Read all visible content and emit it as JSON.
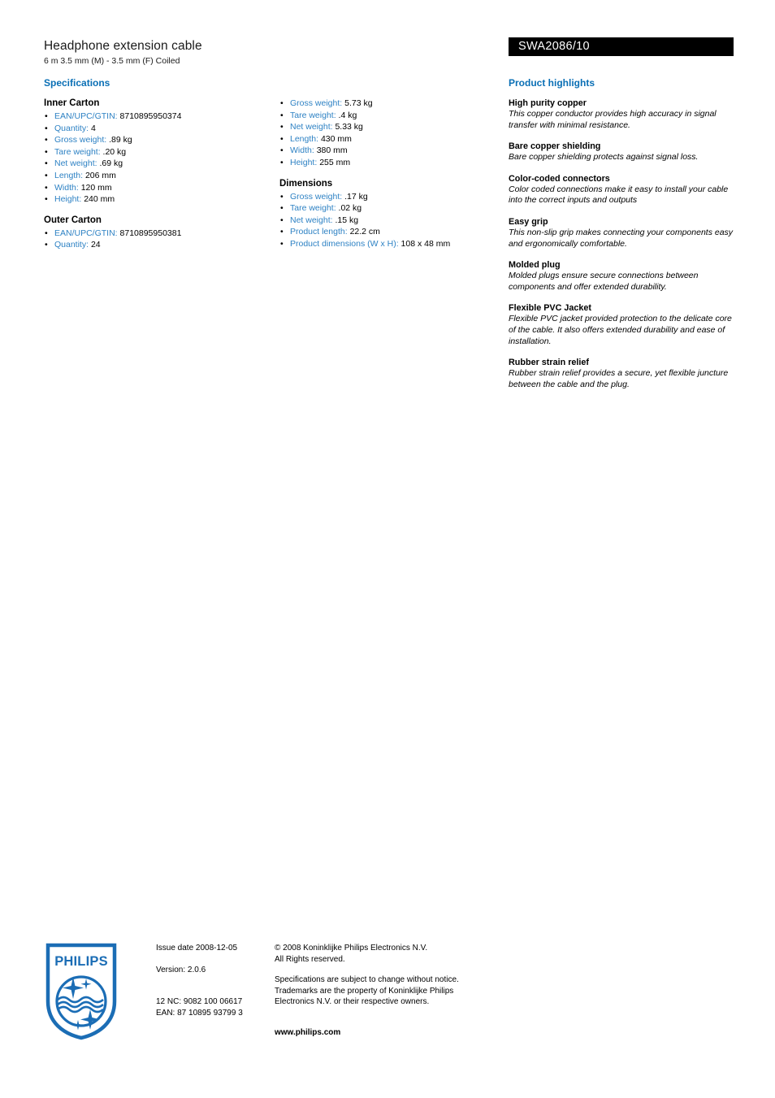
{
  "header": {
    "title": "Headphone extension cable",
    "subtitle": "6 m 3.5 mm (M) - 3.5 mm (F) Coiled",
    "model_code": "SWA2086/10"
  },
  "colors": {
    "heading_blue": "#0A6FB5",
    "label_blue": "#2E82C4",
    "banner_bg": "#000000",
    "logo_blue": "#1B6DB5"
  },
  "specifications": {
    "heading": "Specifications",
    "column1": [
      {
        "title": "Inner Carton",
        "items": [
          {
            "label": "EAN/UPC/GTIN:",
            "value": "8710895950374"
          },
          {
            "label": "Quantity:",
            "value": "4"
          },
          {
            "label": "Gross weight:",
            "value": ".89 kg"
          },
          {
            "label": "Tare weight:",
            "value": ".20 kg"
          },
          {
            "label": "Net weight:",
            "value": ".69 kg"
          },
          {
            "label": "Length:",
            "value": "206 mm"
          },
          {
            "label": "Width:",
            "value": "120 mm"
          },
          {
            "label": "Height:",
            "value": "240 mm"
          }
        ]
      },
      {
        "title": "Outer Carton",
        "items": [
          {
            "label": "EAN/UPC/GTIN:",
            "value": "8710895950381"
          },
          {
            "label": "Quantity:",
            "value": "24"
          }
        ]
      }
    ],
    "column2": [
      {
        "title": "",
        "headless": true,
        "items": [
          {
            "label": "Gross weight:",
            "value": "5.73 kg"
          },
          {
            "label": "Tare weight:",
            "value": ".4 kg"
          },
          {
            "label": "Net weight:",
            "value": "5.33 kg"
          },
          {
            "label": "Length:",
            "value": "430 mm"
          },
          {
            "label": "Width:",
            "value": "380 mm"
          },
          {
            "label": "Height:",
            "value": "255 mm"
          }
        ]
      },
      {
        "title": "Dimensions",
        "items": [
          {
            "label": "Gross weight:",
            "value": ".17 kg"
          },
          {
            "label": "Tare weight:",
            "value": ".02 kg"
          },
          {
            "label": "Net weight:",
            "value": ".15 kg"
          },
          {
            "label": "Product length:",
            "value": "22.2 cm"
          },
          {
            "label": "Product dimensions (W x H):",
            "value": "108 x 48 mm"
          }
        ]
      }
    ],
    "bullet_glyph": "•"
  },
  "highlights": {
    "heading": "Product highlights",
    "items": [
      {
        "title": "High purity copper",
        "desc": "This copper conductor provides high accuracy in signal transfer with minimal resistance."
      },
      {
        "title": "Bare copper shielding",
        "desc": "Bare copper shielding protects against signal loss."
      },
      {
        "title": "Color-coded connectors",
        "desc": "Color coded connections make it easy to install your cable into the correct inputs and outputs"
      },
      {
        "title": "Easy grip",
        "desc": "This non-slip grip makes connecting your components easy and ergonomically comfortable."
      },
      {
        "title": "Molded plug",
        "desc": "Molded plugs ensure secure connections between components and offer extended durability."
      },
      {
        "title": "Flexible PVC Jacket",
        "desc": "Flexible PVC jacket provided protection to the delicate core of the cable. It also offers extended durability and ease of installation."
      },
      {
        "title": "Rubber strain relief",
        "desc": "Rubber strain relief provides a secure, yet flexible juncture between the cable and the plug."
      }
    ]
  },
  "footer": {
    "logo_wordmark": "PHILIPS",
    "issue_date": "Issue date 2008-12-05",
    "version": "Version: 2.0.6",
    "twelve_nc": "12 NC: 9082 100 06617",
    "ean": "EAN: 87 10895 93799 3",
    "copyright_line1": "© 2008 Koninklijke Philips Electronics N.V.",
    "copyright_line2": "All Rights reserved.",
    "disclaimer": "Specifications are subject to change without notice. Trademarks are the property of Koninklijke Philips Electronics N.V. or their respective owners.",
    "website": "www.philips.com"
  }
}
